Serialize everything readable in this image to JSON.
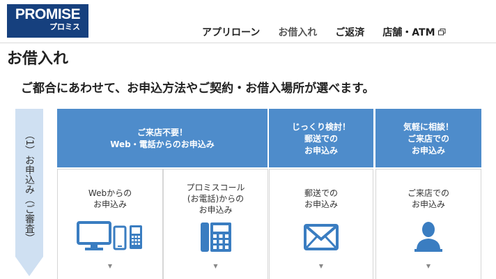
{
  "header": {
    "logo": {
      "main": "PROMISE",
      "sub": "プロミス"
    },
    "nav": [
      {
        "label": "アプリローン"
      },
      {
        "label": "お借入れ"
      },
      {
        "label": "ご返済"
      },
      {
        "label": "店舗・ATM",
        "icon": "external-link-icon"
      }
    ]
  },
  "page": {
    "title": "お借入れ",
    "subtitle": "ご都合にあわせて、お申込方法やご契約・お借入場所が選べます。"
  },
  "step": {
    "label": "（1）お申込み（ご審査）"
  },
  "groups": [
    {
      "lines": [
        "ご来店不要！",
        "Web・電話からのお申込み"
      ]
    },
    {
      "lines": [
        "じっくり検討！",
        "郵送での",
        "お申込み"
      ]
    },
    {
      "lines": [
        "気軽に相談！",
        "ご来店での",
        "お申込み"
      ]
    }
  ],
  "methods": [
    {
      "lines": [
        "Webからの",
        "お申込み"
      ],
      "icon": "pc-and-phone-icon"
    },
    {
      "lines": [
        "プロミスコール",
        "(お電話)からの",
        "お申込み"
      ],
      "icon": "telephone-icon"
    },
    {
      "lines": [
        "郵送での",
        "お申込み"
      ],
      "icon": "envelope-icon"
    },
    {
      "lines": [
        "ご来店での",
        "お申込み"
      ],
      "icon": "person-icon"
    }
  ],
  "chevron": "▼",
  "colors": {
    "brand": "#16407e",
    "accent_blue": "#4e8ccb",
    "icon_blue": "#3a7dc1",
    "arrow_bg": "#cfe0f2"
  }
}
